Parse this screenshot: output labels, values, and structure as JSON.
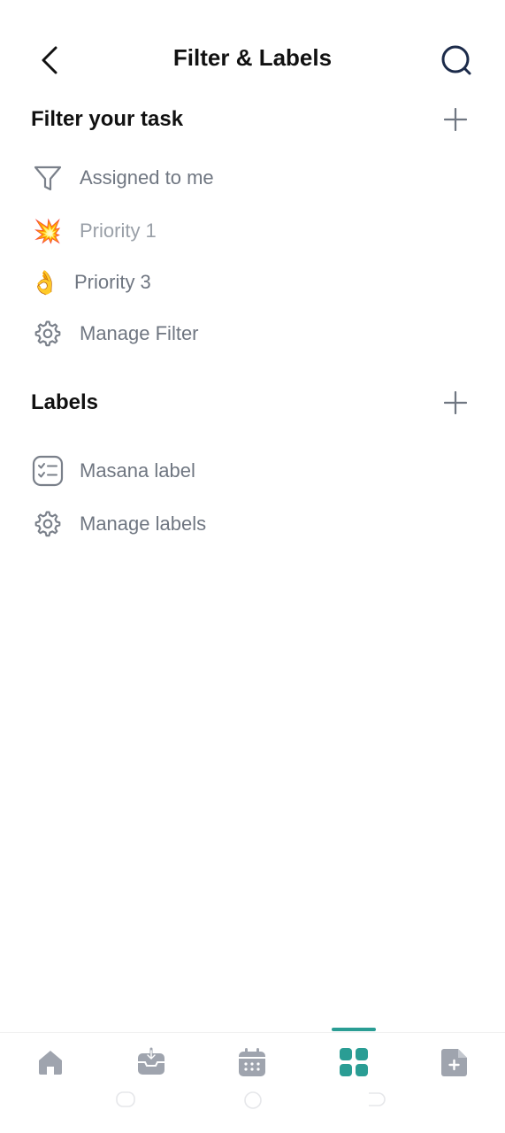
{
  "header": {
    "title": "Filter & Labels",
    "back_icon": "chevron-left-icon",
    "search_icon": "search-icon"
  },
  "filters": {
    "title": "Filter your task",
    "add_icon": "plus-icon",
    "items": [
      {
        "label": "Assigned to me",
        "icon": "funnel-icon"
      },
      {
        "label": "Priority 1",
        "icon": "collision-emoji",
        "emoji": "💥"
      },
      {
        "label": "Priority 3",
        "icon": "ok-hand-emoji",
        "emoji": "👌"
      },
      {
        "label": "Manage Filter",
        "icon": "gear-icon"
      }
    ]
  },
  "labels": {
    "title": "Labels",
    "add_icon": "plus-icon",
    "items": [
      {
        "label": "Masana label",
        "icon": "checklist-icon"
      },
      {
        "label": "Manage labels",
        "icon": "gear-icon"
      }
    ]
  },
  "bottom_nav": {
    "active_index": 3,
    "items": [
      {
        "icon": "home-icon"
      },
      {
        "icon": "inbox-icon"
      },
      {
        "icon": "calendar-icon"
      },
      {
        "icon": "grid-icon"
      },
      {
        "icon": "add-note-icon"
      }
    ]
  },
  "colors": {
    "accent": "#2a9d94",
    "icon_gray": "#8a909a",
    "text_gray": "#6f7681",
    "nav_gray": "#a3a8b2"
  }
}
